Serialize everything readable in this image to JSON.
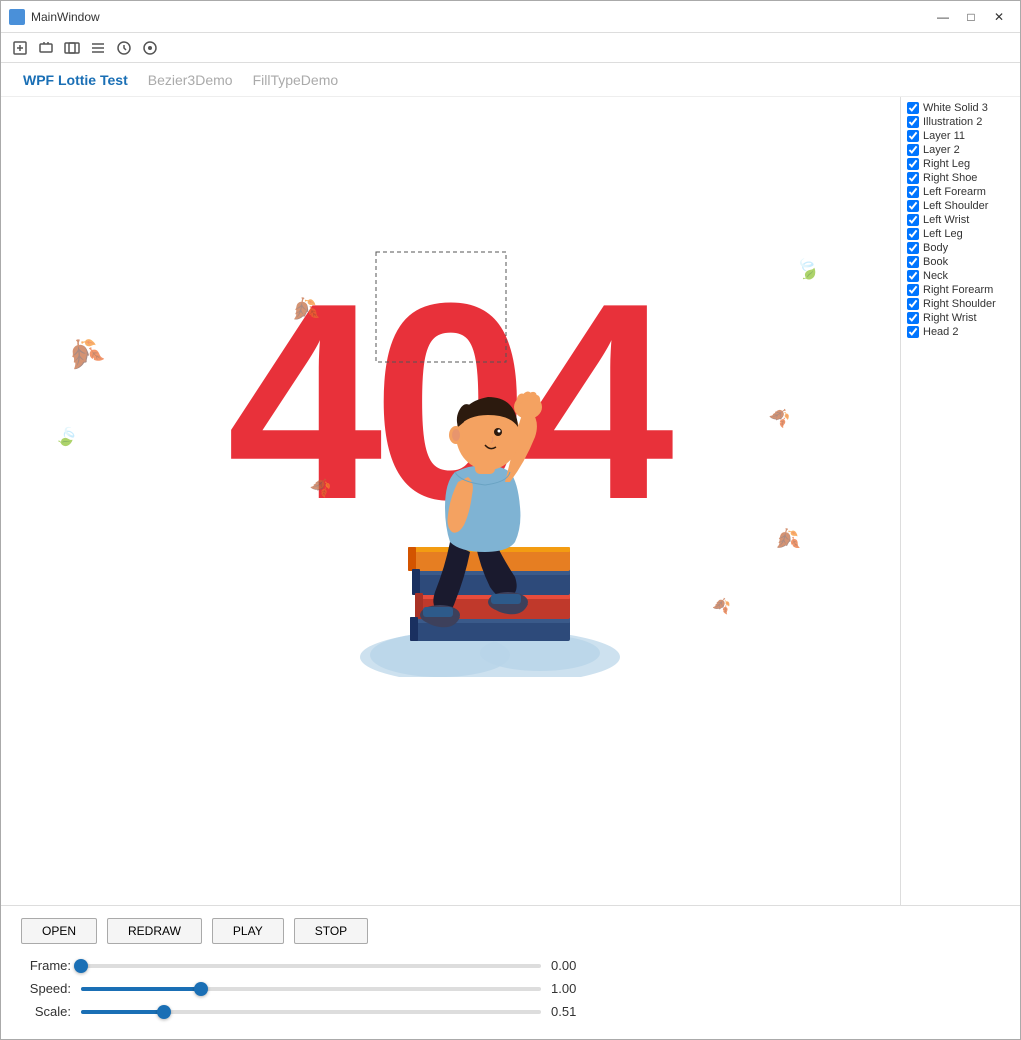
{
  "window": {
    "title": "MainWindow"
  },
  "menu": {
    "items": [
      {
        "label": "WPF Lottie Test",
        "active": true
      },
      {
        "label": "Bezier3Demo",
        "active": false
      },
      {
        "label": "FillTypeDemo",
        "active": false
      }
    ]
  },
  "layers": [
    {
      "label": "White Solid 3",
      "checked": true
    },
    {
      "label": "Illustration 2",
      "checked": true
    },
    {
      "label": "Layer 11",
      "checked": true
    },
    {
      "label": "Layer 2",
      "checked": true
    },
    {
      "label": "Right Leg",
      "checked": true
    },
    {
      "label": "Right Shoe",
      "checked": true
    },
    {
      "label": "Left Forearm",
      "checked": true
    },
    {
      "label": "Left Shoulder",
      "checked": true
    },
    {
      "label": "Left Wrist",
      "checked": true
    },
    {
      "label": "Left Leg",
      "checked": true
    },
    {
      "label": "Body",
      "checked": true
    },
    {
      "label": "Book",
      "checked": true
    },
    {
      "label": "Neck",
      "checked": true
    },
    {
      "label": "Right Forearm",
      "checked": true
    },
    {
      "label": "Right Shoulder",
      "checked": true
    },
    {
      "label": "Right Wrist",
      "checked": true
    },
    {
      "label": "Head 2",
      "checked": true
    }
  ],
  "buttons": {
    "open": "OPEN",
    "redraw": "REDRAW",
    "play": "PLAY",
    "stop": "STOP"
  },
  "sliders": {
    "frame": {
      "label": "Frame:",
      "value": "0.00",
      "position": 0
    },
    "speed": {
      "label": "Speed:",
      "value": "1.00",
      "position": 0.26
    },
    "scale": {
      "label": "Scale:",
      "value": "0.51",
      "position": 0.18
    }
  },
  "colors": {
    "accent": "#1a6fb5",
    "red": "#e8313a",
    "char_shirt": "#7fb3d3",
    "char_pants": "#1a1a2e",
    "char_skin": "#f4a261",
    "char_shoes": "#3d405b",
    "book1": "#2d4a7a",
    "book2": "#c0392b",
    "book3": "#e67e22",
    "cloud": "#b8d4e8"
  }
}
